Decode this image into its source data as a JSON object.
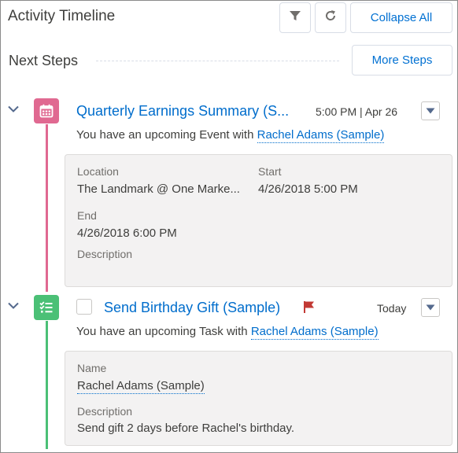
{
  "header": {
    "title": "Activity Timeline",
    "filter_icon": "filter-icon",
    "refresh_icon": "refresh-icon",
    "collapse_all_label": "Collapse All"
  },
  "next_steps": {
    "label": "Next Steps",
    "more_steps_label": "More Steps"
  },
  "colors": {
    "event": "#e06991",
    "task": "#4bc076",
    "link": "#006dcc"
  },
  "items": [
    {
      "type": "event",
      "icon": "calendar-icon",
      "title": "Quarterly Earnings Summary (S...",
      "time": "5:00 PM | Apr 26",
      "summary_prefix": "You have an upcoming Event with",
      "contact": "Rachel Adams (Sample)",
      "details": {
        "location_label": "Location",
        "location_value": "The Landmark @ One Marke...",
        "start_label": "Start",
        "start_value": "4/26/2018 5:00 PM",
        "end_label": "End",
        "end_value": "4/26/2018 6:00 PM",
        "description_label": "Description"
      }
    },
    {
      "type": "task",
      "icon": "task-icon",
      "title": "Send Birthday Gift (Sample)",
      "time": "Today",
      "summary_prefix": "You have an upcoming Task with",
      "contact": "Rachel Adams (Sample)",
      "details": {
        "name_label": "Name",
        "name_value": "Rachel Adams (Sample)",
        "description_label": "Description",
        "description_value": "Send gift 2 days before Rachel's birthday."
      }
    }
  ]
}
